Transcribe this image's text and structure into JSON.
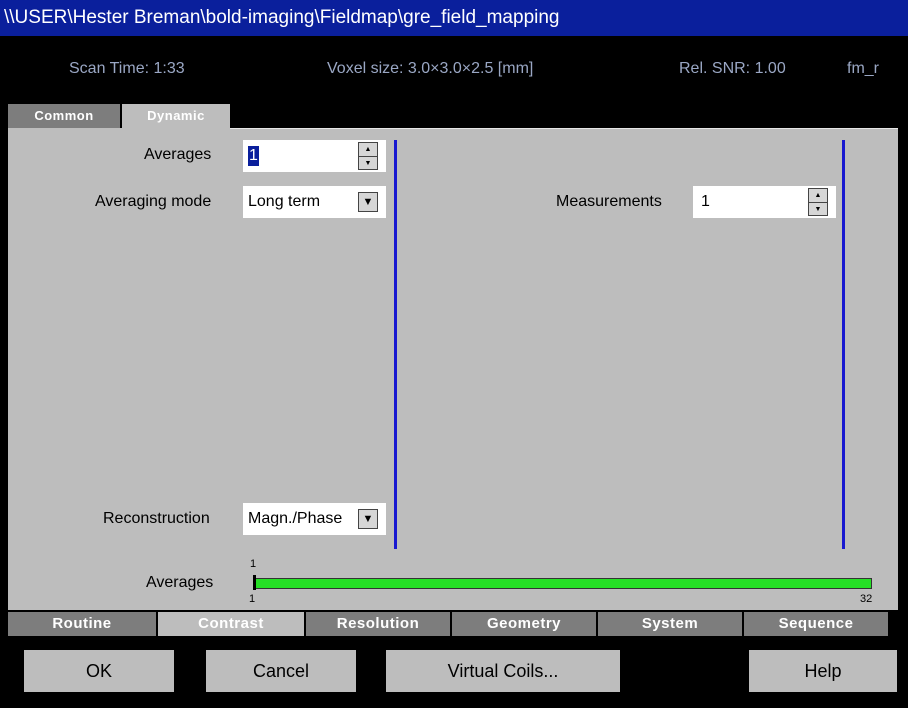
{
  "window": {
    "title": "\\\\USER\\Hester Breman\\bold-imaging\\Fieldmap\\gre_field_mapping"
  },
  "info": {
    "scan_time": "Scan Time: 1:33",
    "voxel_size": "Voxel size: 3.0×3.0×2.5 [mm]",
    "rel_snr": "Rel. SNR: 1.00",
    "protocol": "fm_r"
  },
  "subtabs": [
    {
      "label": "Common",
      "active": false
    },
    {
      "label": "Dynamic",
      "active": true
    }
  ],
  "fields": {
    "averages": {
      "label": "Averages",
      "value": "1"
    },
    "averaging_mode": {
      "label": "Averaging mode",
      "value": "Long term"
    },
    "reconstruction": {
      "label": "Reconstruction",
      "value": "Magn./Phase"
    },
    "measurements": {
      "label": "Measurements",
      "value": "1"
    }
  },
  "slider": {
    "label": "Averages",
    "value": 1,
    "min": "1",
    "max": "32",
    "current": "1"
  },
  "main_tabs": [
    {
      "label": "Routine",
      "active": false
    },
    {
      "label": "Contrast",
      "active": true
    },
    {
      "label": "Resolution",
      "active": false
    },
    {
      "label": "Geometry",
      "active": false
    },
    {
      "label": "System",
      "active": false
    },
    {
      "label": "Sequence",
      "active": false
    }
  ],
  "buttons": {
    "ok": "OK",
    "cancel": "Cancel",
    "virtual_coils": "Virtual Coils...",
    "help": "Help"
  },
  "colors": {
    "title_bar": "#0a1f9c",
    "panel": "#bdbdbd",
    "accent_line": "#1818d0",
    "slider_fill": "#26e026"
  }
}
